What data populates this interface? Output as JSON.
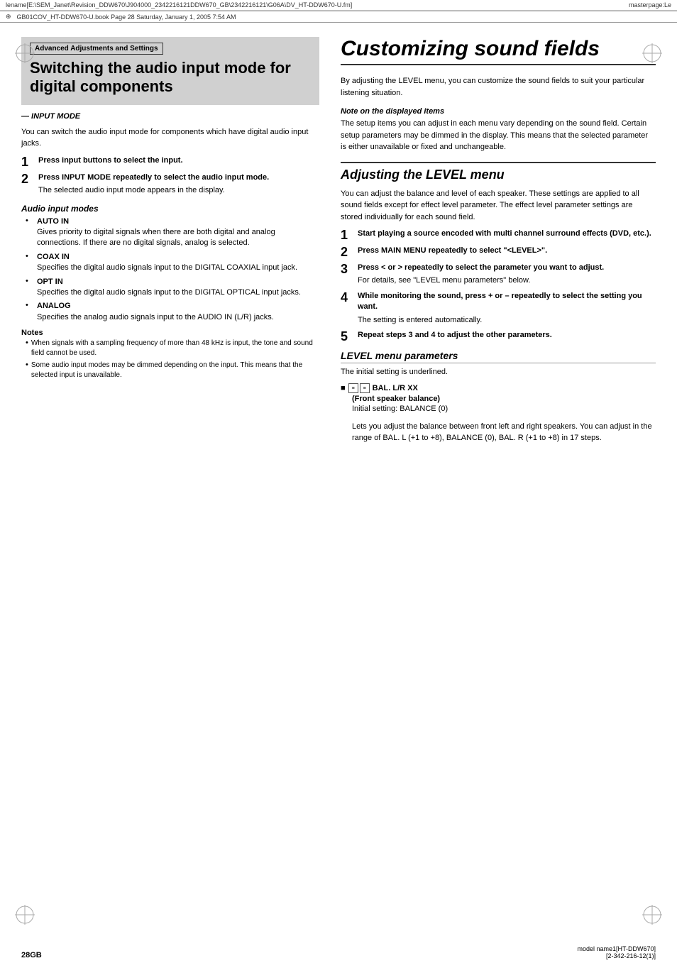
{
  "topbar": {
    "filename": "lename[E:\\SEM_Janet\\Revision_DDW670\\J904000_2342216121DDW670_GB\\2342216121\\G06A\\DV_HT-DDW670-U.fm]",
    "masterpage": "masterpage:Le"
  },
  "ruleline": {
    "text": "GB01COV_HT-DDW670-U.book  Page 28  Saturday, January 1, 2005  7:54 AM"
  },
  "left": {
    "section_label": "Advanced Adjustments and Settings",
    "title": "Switching the audio input mode for digital components",
    "input_mode_label": "— INPUT MODE",
    "intro": "You can switch the audio input mode for components which have digital audio input jacks.",
    "steps": [
      {
        "num": "1",
        "text": "Press input buttons to select the input."
      },
      {
        "num": "2",
        "text": "Press INPUT MODE repeatedly to select the audio input mode.",
        "sub": "The selected audio input mode appears in the display."
      }
    ],
    "audio_input_modes_heading": "Audio input modes",
    "modes": [
      {
        "name": "AUTO IN",
        "desc": "Gives priority to digital signals when there are both digital and analog connections. If there are no digital signals, analog is selected."
      },
      {
        "name": "COAX IN",
        "desc": "Specifies the digital audio signals input to the DIGITAL COAXIAL input jack."
      },
      {
        "name": "OPT IN",
        "desc": "Specifies the digital audio signals input to the DIGITAL OPTICAL input jacks."
      },
      {
        "name": "ANALOG",
        "desc": "Specifies the analog audio signals input to the AUDIO IN (L/R) jacks."
      }
    ],
    "notes_heading": "Notes",
    "notes": [
      "When signals with a sampling frequency of more than 48 kHz is input, the tone and sound field cannot be used.",
      "Some audio input modes may be dimmed depending on the input. This means that the selected input is unavailable."
    ]
  },
  "right": {
    "page_title": "Customizing sound fields",
    "intro": "By adjusting the LEVEL menu, you can customize the sound fields to suit your particular listening situation.",
    "note_on_display": {
      "heading": "Note on the displayed items",
      "text": "The setup items you can adjust in each menu vary depending on the sound field. Certain setup parameters may be dimmed in the display. This means that the selected parameter is either unavailable or fixed and unchangeable."
    },
    "adjusting_heading": "Adjusting the LEVEL menu",
    "adjusting_intro": "You can adjust the balance and level of each speaker. These settings are applied to all sound fields except for effect level parameter. The effect level parameter settings are stored individually for each sound field.",
    "steps": [
      {
        "num": "1",
        "text": "Start playing a source encoded with multi channel surround effects (DVD, etc.)."
      },
      {
        "num": "2",
        "text": "Press MAIN MENU repeatedly to select \"<LEVEL>\"."
      },
      {
        "num": "3",
        "text": "Press < or > repeatedly to select the parameter you want to adjust.",
        "sub": "For details, see \"LEVEL menu parameters\" below."
      },
      {
        "num": "4",
        "text": "While monitoring the sound, press + or – repeatedly to select the setting you want.",
        "sub": "The setting is entered automatically."
      },
      {
        "num": "5",
        "text": "Repeat steps 3 and 4 to adjust the other parameters."
      }
    ],
    "level_menu_params_heading": "LEVEL menu parameters",
    "level_initial": "The initial setting is underlined.",
    "level_params": [
      {
        "icon1": "≡≡",
        "icon2": "≡≡",
        "title": "BAL. L/R XX",
        "subtitle": "(Front speaker balance)",
        "initial": "Initial setting: BALANCE (0)",
        "desc": "Lets you adjust the balance between front left and right speakers. You can adjust in the range of BAL. L (+1 to +8), BALANCE (0), BAL. R (+1 to +8) in 17 steps."
      }
    ]
  },
  "footer": {
    "page_num": "28GB",
    "model": "model name1[HT-DDW670]",
    "code": "[2-342-216-12(1)]"
  }
}
